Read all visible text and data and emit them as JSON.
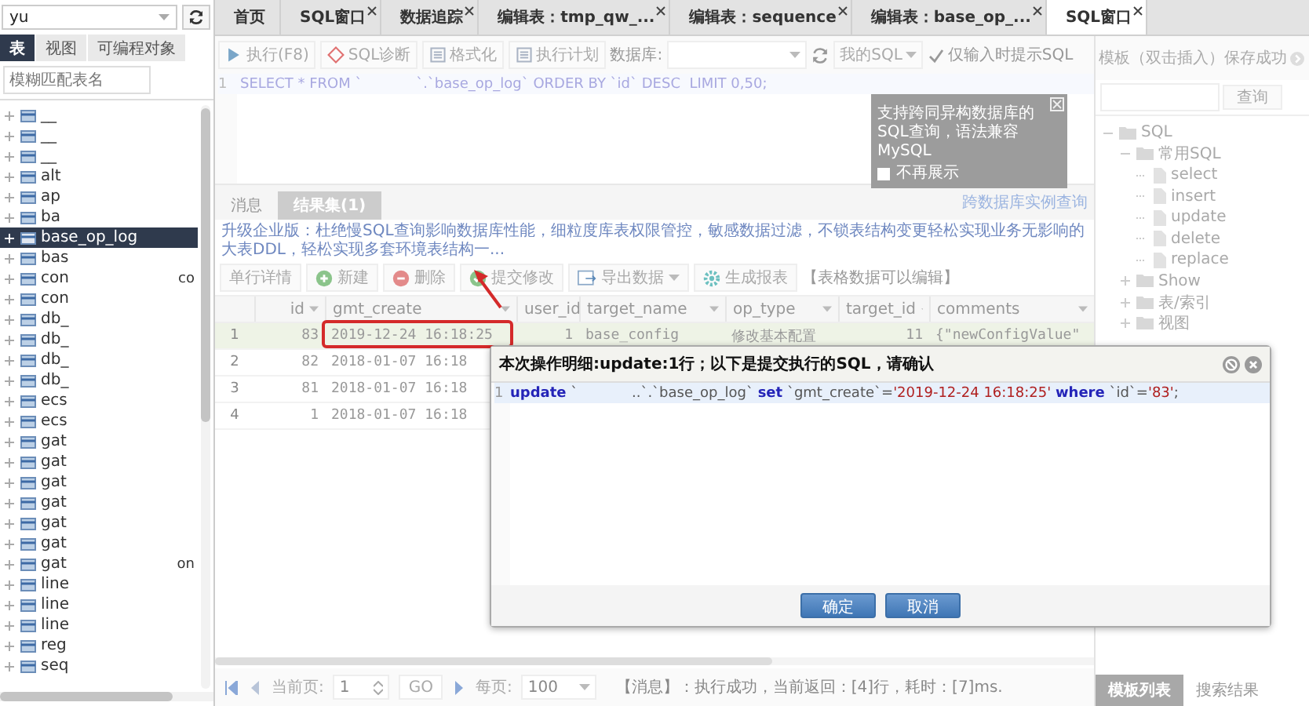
{
  "sidebar": {
    "database": "yu",
    "tabs": [
      {
        "label": "表",
        "selected": true
      },
      {
        "label": "视图",
        "selected": false
      },
      {
        "label": "可编程对象",
        "selected": false
      }
    ],
    "filter": {
      "placeholder": "模糊匹配表名"
    },
    "tables": [
      {
        "name": "__",
        "selected": false
      },
      {
        "name": "__",
        "selected": false
      },
      {
        "name": "__",
        "selected": false
      },
      {
        "name": "alt",
        "selected": false
      },
      {
        "name": "ap",
        "selected": false
      },
      {
        "name": "ba",
        "selected": false
      },
      {
        "name": "base_op_log",
        "selected": true
      },
      {
        "name": "bas",
        "selected": false
      },
      {
        "name": "con",
        "note": "co",
        "selected": false
      },
      {
        "name": "con",
        "selected": false
      },
      {
        "name": "db_",
        "selected": false
      },
      {
        "name": "db_",
        "selected": false
      },
      {
        "name": "db_",
        "selected": false
      },
      {
        "name": "db_",
        "selected": false
      },
      {
        "name": "ecs",
        "selected": false
      },
      {
        "name": "ecs",
        "selected": false
      },
      {
        "name": "gat",
        "selected": false
      },
      {
        "name": "gat",
        "selected": false
      },
      {
        "name": "gat",
        "selected": false
      },
      {
        "name": "gat",
        "selected": false
      },
      {
        "name": "gat",
        "selected": false
      },
      {
        "name": "gat",
        "selected": false
      },
      {
        "name": "gat",
        "note": "on",
        "selected": false
      },
      {
        "name": "line",
        "selected": false
      },
      {
        "name": "line",
        "selected": false
      },
      {
        "name": "line",
        "selected": false
      },
      {
        "name": "reg",
        "selected": false
      },
      {
        "name": "seq",
        "selected": false
      }
    ]
  },
  "tabs": [
    {
      "label": "首页",
      "closable": false,
      "selected": false
    },
    {
      "label": "SQL窗口",
      "closable": true,
      "selected": false
    },
    {
      "label": "数据追踪",
      "closable": true,
      "selected": false
    },
    {
      "label": "编辑表：tmp_qw_...",
      "closable": true,
      "selected": false
    },
    {
      "label": "编辑表：sequence",
      "closable": true,
      "selected": false
    },
    {
      "label": "编辑表：base_op_...",
      "closable": true,
      "selected": false
    },
    {
      "label": "SQL窗口",
      "closable": true,
      "selected": true
    }
  ],
  "toolbar": {
    "buttons": [
      "执行(F8)",
      "SQL诊断",
      "格式化",
      "执行计划"
    ],
    "database_label": "数据库:",
    "my_sql": "我的SQL",
    "hint_option": {
      "label": "仅输入时提示SQL",
      "checked": true
    }
  },
  "editor": {
    "lines": [
      {
        "number": "1",
        "code": "SELECT * FROM `            `.`base_op_log` ORDER BY `id` DESC  LIMIT 0,50;"
      }
    ]
  },
  "hint_popup": {
    "text": "支持跨同异构数据库的SQL查询，语法兼容MySQL",
    "dont_show": {
      "label": "不再展示",
      "checked": false
    }
  },
  "results": {
    "tabs": [
      {
        "label": "消息",
        "selected": false
      },
      {
        "label": "结果集(1)",
        "selected": true
      }
    ],
    "link": "跨数据库实例查询",
    "banner": "升级企业版：杜绝慢SQL查询影响数据库性能，细粒度库表权限管控，敏感数据过滤，不锁表结构变更轻松实现业务无影响的大表DDL，轻松实现多套环境表结构一...",
    "actions": [
      {
        "label": "单行详情",
        "disabled": false
      },
      {
        "label": "新建",
        "disabled": false
      },
      {
        "label": "删除",
        "disabled": false
      },
      {
        "label": "提交修改",
        "disabled": false
      },
      {
        "label": "导出数据",
        "disabled": false
      },
      {
        "label": "生成报表",
        "disabled": false
      }
    ],
    "edit_note": "【表格数据可以编辑】",
    "columns": [
      "id",
      "gmt_create",
      "user_id",
      "target_name",
      "op_type",
      "target_id",
      "comments"
    ],
    "rows": [
      {
        "number": "1",
        "selected": true,
        "cells": [
          "83",
          "2019-12-24 16:18:25",
          "1",
          "base_config",
          "修改基本配置",
          "11",
          "{\"newConfigValue\""
        ]
      },
      {
        "number": "2",
        "selected": false,
        "cells": [
          "82",
          "2018-01-07 16:18"
        ]
      },
      {
        "number": "3",
        "selected": false,
        "cells": [
          "81",
          "2018-01-07 16:18"
        ]
      },
      {
        "number": "4",
        "selected": false,
        "cells": [
          "1",
          "2018-01-07 16:18"
        ]
      }
    ],
    "pager": {
      "page_label": "当前页:",
      "page": "1",
      "go": "GO",
      "per_page_label": "每页:",
      "per_page": "100",
      "message": "【消息】：执行成功，当前返回：[4]行，耗时：[7]ms."
    }
  },
  "templates": {
    "title": "模板（双击插入）保存成功",
    "search_button": "查询",
    "tree": [
      {
        "label": "SQL",
        "kind": "folder",
        "expanded": true,
        "children": [
          {
            "label": "常用SQL",
            "kind": "folder",
            "expanded": true,
            "children": [
              {
                "label": "select",
                "kind": "file"
              },
              {
                "label": "insert",
                "kind": "file"
              },
              {
                "label": "update",
                "kind": "file"
              },
              {
                "label": "delete",
                "kind": "file"
              },
              {
                "label": "replace",
                "kind": "file"
              }
            ]
          },
          {
            "label": "Show",
            "kind": "folder",
            "expanded": false
          },
          {
            "label": "表/索引",
            "kind": "folder",
            "expanded": false
          },
          {
            "label": "视图",
            "kind": "folder",
            "expanded": false
          }
        ]
      }
    ],
    "tabs": [
      {
        "label": "模板列表",
        "selected": true
      },
      {
        "label": "搜索结果",
        "selected": false
      }
    ]
  },
  "dialog": {
    "title": "本次操作明细:update:1行；以下是提交执行的SQL，请确认",
    "lines": [
      {
        "number": "1",
        "tokens": [
          {
            "text": "update",
            "kind": "keyword"
          },
          {
            "text": " `            ..`.`base_op_log` ",
            "kind": "ident"
          },
          {
            "text": "set",
            "kind": "keyword"
          },
          {
            "text": " `gmt_create`=",
            "kind": "ident"
          },
          {
            "text": "'2019-12-24 16:18:25' ",
            "kind": "string"
          },
          {
            "text": "where",
            "kind": "keyword"
          },
          {
            "text": " `id`=",
            "kind": "ident"
          },
          {
            "text": "'83'",
            "kind": "string"
          },
          {
            "text": ";",
            "kind": "ident"
          }
        ]
      }
    ],
    "buttons": [
      "确定",
      "取消"
    ]
  }
}
